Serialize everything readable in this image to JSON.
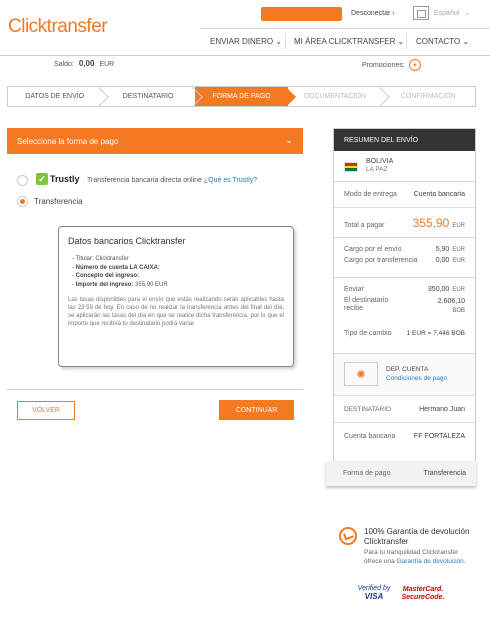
{
  "header": {
    "logo_a": "Click",
    "logo_b": "transfer",
    "disconnect": "Desconectar",
    "language": "Español",
    "nav": [
      "ENVIAR DINERO",
      "MI ÁREA CLICKTRANSFER",
      "CONTACTO"
    ]
  },
  "account": {
    "saldo_label": "Saldo:",
    "saldo_value": "0,00",
    "saldo_currency": "EUR",
    "promotions_label": "Promociones:"
  },
  "steps": [
    {
      "label": "DATOS DE ENVÍO",
      "state": "done"
    },
    {
      "label": "DESTINATARIO",
      "state": "done"
    },
    {
      "label": "FORMA DE PAGO",
      "state": "active"
    },
    {
      "label": "DOCUMENTACIÓN",
      "state": "inactive"
    },
    {
      "label": "CONFIRMACIÓN",
      "state": "inactive"
    }
  ],
  "payment": {
    "select_title": "Selecciona la forma de pago",
    "trustly_name": "Trustly",
    "trustly_desc": "Transferencia bancaria directa online",
    "trustly_link": "¿Qué es Trustly?",
    "transfer_label": "Transferencia",
    "bank_title": "Datos bancarios Clicktransfer",
    "bank_holder_label": "Titular:",
    "bank_holder_value": "Clicktransfer",
    "bank_account_label": "Número de cuenta LA CAIXA:",
    "bank_concept_label": "Concepto del ingreso:",
    "bank_amount_label": "Importe del ingreso:",
    "bank_amount_value": "355,90 EUR",
    "bank_note": "Las tasas disponibles para el envío que estás realizando serán aplicables hasta las 23:59 de hoy. En caso de no realizar la transferencia antes del final del día, se aplicarán las tasas del día en que se realice dicha transferencia, por lo que el importe que recibirá tu destinatario podrá variar.",
    "back_button": "VOLVER",
    "continue_button": "CONTINUAR"
  },
  "summary": {
    "title": "RESUMEN DEL ENVÍO",
    "country": "BOLIVIA",
    "city": "LA PAZ",
    "delivery_label": "Modo de entrega",
    "delivery_value": "Cuenta bancaria",
    "total_label": "Total a pagar",
    "total_value": "355,90",
    "total_currency": "EUR",
    "fee_send_label": "Cargo por el envío",
    "fee_send_value": "5,90",
    "fee_send_currency": "EUR",
    "fee_transfer_label": "Cargo por transferencia",
    "fee_transfer_value": "0,00",
    "fee_transfer_currency": "EUR",
    "send_label": "Enviar",
    "send_value": "350,00",
    "send_currency": "EUR",
    "receive_label_1": "El destinatario",
    "receive_label_2": "recibe",
    "receive_value": "2.606,10",
    "receive_currency": "BOB",
    "rate_label": "Tipo de cambio",
    "rate_value": "1 EUR = 7,446 BOB",
    "bank_name": "DEP. CUENTA",
    "bank_conditions": "Condiciones de pago",
    "recipient_label": "DESTINATARIO",
    "recipient_value": "Hermano Juan",
    "account_label": "Cuenta bancaria",
    "account_value": "FF FORTALEZA",
    "payment_label": "Forma de pago",
    "payment_value": "Transferencia"
  },
  "guarantee": {
    "title": "100% Garantía de devolución Clicktransfer",
    "text": "Para tu tranquilidad Clicktransfer ofrece una",
    "link": "Garantía de devolución.",
    "visa_1": "Verified by",
    "visa_2": "VISA",
    "mc_1": "MasterCard.",
    "mc_2": "SecureCode."
  },
  "colors": {
    "accent": "#f47920",
    "dark": "#333333",
    "link": "#2a7abf"
  }
}
